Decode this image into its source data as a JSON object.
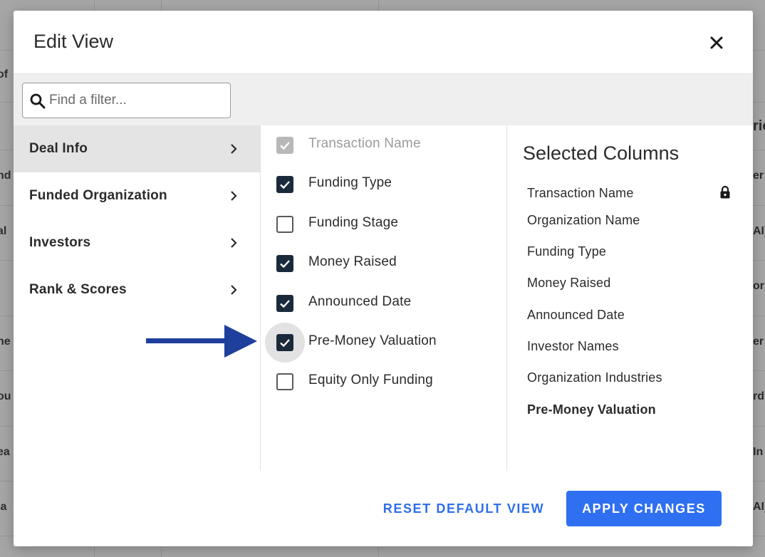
{
  "background": {
    "left_fragments": [
      "of",
      "nd",
      "al",
      "ne",
      "ou",
      "ea",
      "ia"
    ],
    "right_fragments": [
      "rie",
      "er",
      "AI)",
      "or",
      "er",
      "rd",
      "In",
      "AI)"
    ]
  },
  "modal": {
    "title": "Edit View",
    "close_icon": "close-icon"
  },
  "search": {
    "placeholder": "Find a filter...",
    "icon": "search-icon"
  },
  "categories": [
    {
      "label": "Deal Info",
      "active": true
    },
    {
      "label": "Funded Organization",
      "active": false
    },
    {
      "label": "Investors",
      "active": false
    },
    {
      "label": "Rank & Scores",
      "active": false
    }
  ],
  "options": [
    {
      "label": "Transaction Name",
      "state": "checked-disabled"
    },
    {
      "label": "Funding Type",
      "state": "checked"
    },
    {
      "label": "Funding Stage",
      "state": "unchecked"
    },
    {
      "label": "Money Raised",
      "state": "checked"
    },
    {
      "label": "Announced Date",
      "state": "checked"
    },
    {
      "label": "Pre-Money Valuation",
      "state": "checked",
      "focused": true
    },
    {
      "label": "Equity Only Funding",
      "state": "unchecked"
    }
  ],
  "selected": {
    "title": "Selected Columns",
    "items": [
      {
        "label": "Transaction Name",
        "locked": true
      },
      {
        "label": "Organization Name"
      },
      {
        "label": "Funding Type"
      },
      {
        "label": "Money Raised"
      },
      {
        "label": "Announced Date"
      },
      {
        "label": "Investor Names"
      },
      {
        "label": "Organization Industries"
      },
      {
        "label": "Pre-Money Valuation",
        "bold": true
      }
    ]
  },
  "footer": {
    "reset_label": "RESET DEFAULT VIEW",
    "apply_label": "APPLY CHANGES"
  },
  "colors": {
    "accent": "#2f6ff2",
    "checkbox": "#1b2a3b",
    "arrow": "#1f3f9c"
  }
}
